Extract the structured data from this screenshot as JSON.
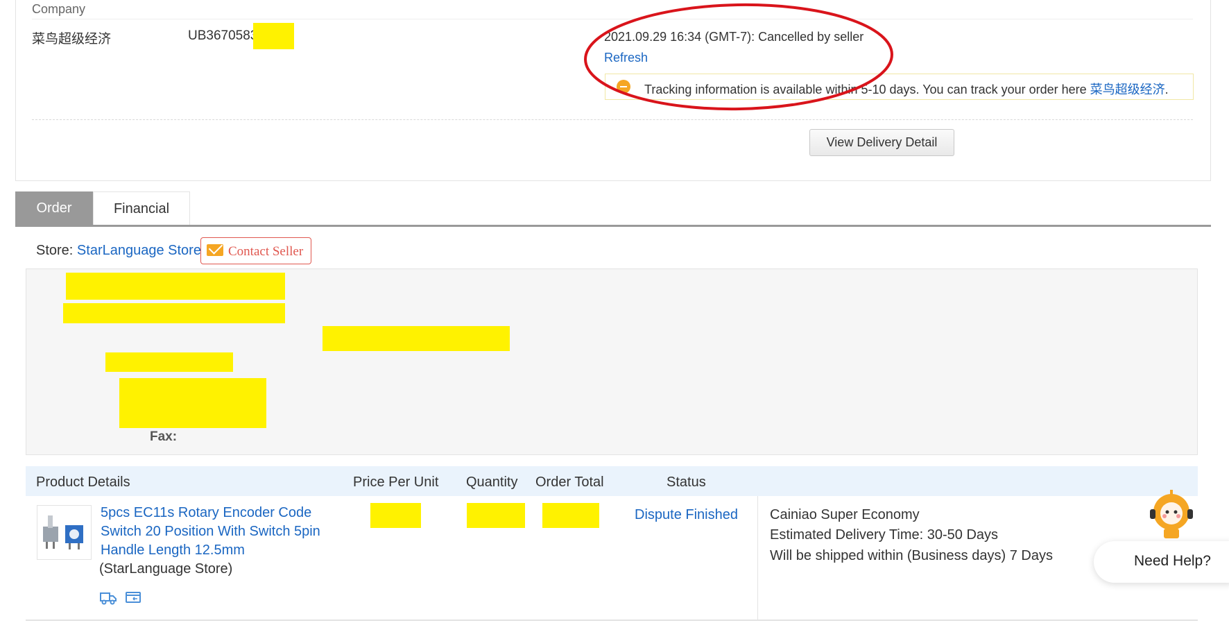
{
  "logistics": {
    "header": "Company",
    "carrier": "菜鸟超级经济",
    "tracking_number": "UB3670583",
    "status_line": "2021.09.29 16:34 (GMT-7): Cancelled by seller",
    "refresh_label": "Refresh",
    "notice_text": "Tracking information is available within 5-10 days. You can track your order here ",
    "notice_link": "菜鸟超级经济",
    "notice_end": ".",
    "view_detail_label": "View Delivery Detail"
  },
  "tabs": [
    {
      "label": "Order",
      "active": true
    },
    {
      "label": "Financial",
      "active": false
    }
  ],
  "store": {
    "prefix": "Store: ",
    "name": "StarLanguage Store",
    "contact_label": "Contact Seller"
  },
  "address": {
    "fax_label": "Fax:"
  },
  "table": {
    "headers": {
      "product": "Product Details",
      "price": "Price Per Unit",
      "quantity": "Quantity",
      "total": "Order Total",
      "status": "Status"
    },
    "row": {
      "title": "5pcs EC11s Rotary Encoder Code Switch 20 Position With Switch 5pin Handle Length 12.5mm",
      "store": "(StarLanguage Store)",
      "status": "Dispute Finished",
      "shipping_method": "Cainiao Super Economy",
      "delivery_time": "Estimated Delivery Time: 30-50 Days",
      "ship_within": "Will be shipped within (Business days) 7 Days"
    }
  },
  "help": {
    "label": "Need Help?"
  },
  "colors": {
    "link": "#1a66c2",
    "redaction": "#fff200",
    "annotation": "#d9141b",
    "tab_active": "#999999",
    "table_header": "#eaf3fc"
  },
  "icons": [
    "notice-icon",
    "envelope-icon",
    "truck-icon",
    "card-icon",
    "mascot-icon"
  ]
}
